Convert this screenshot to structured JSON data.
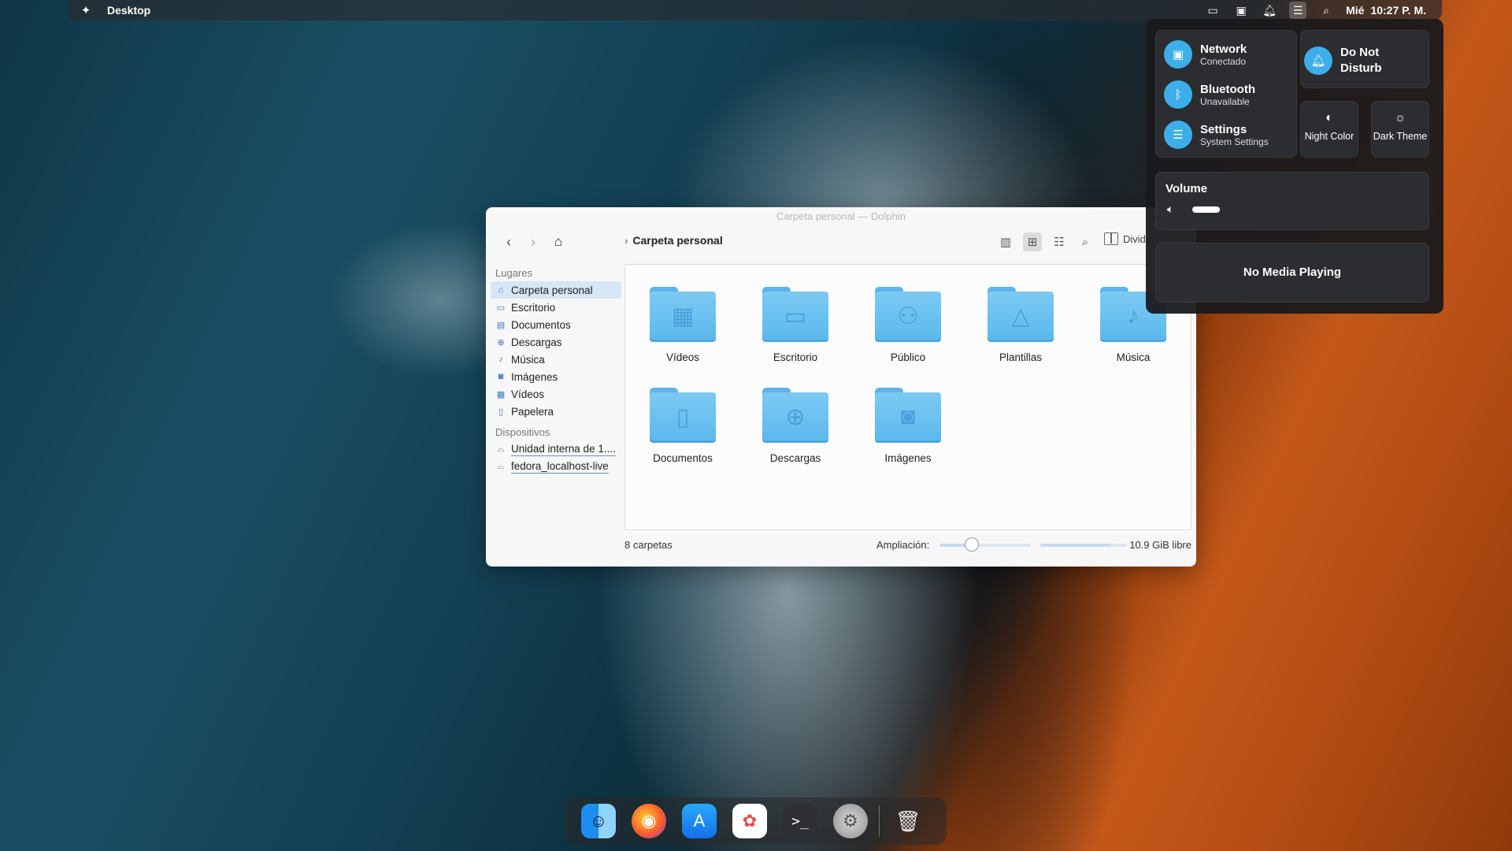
{
  "top_panel": {
    "title": "Desktop",
    "day": "Mié",
    "time": "10:27 P. M."
  },
  "window": {
    "title": "Carpeta personal — Dolphin",
    "breadcrumb": "Carpeta personal",
    "split_label": "Dividir",
    "status_count": "8 carpetas",
    "zoom_label": "Ampliación:",
    "zoom_fraction": 0.35,
    "free_space": "10.9 GiB libre",
    "used_fraction": 0.82
  },
  "sidebar": {
    "places_header": "Lugares",
    "places": [
      {
        "label": "Carpeta personal",
        "icon": "home-icon"
      },
      {
        "label": "Escritorio",
        "icon": "desktop-icon"
      },
      {
        "label": "Documentos",
        "icon": "documents-icon"
      },
      {
        "label": "Descargas",
        "icon": "downloads-icon"
      },
      {
        "label": "Música",
        "icon": "music-icon"
      },
      {
        "label": "Imágenes",
        "icon": "pictures-icon"
      },
      {
        "label": "Vídeos",
        "icon": "videos-icon"
      },
      {
        "label": "Papelera",
        "icon": "trash-icon"
      }
    ],
    "devices_header": "Dispositivos",
    "devices": [
      {
        "label": "Unidad interna de 1...."
      },
      {
        "label": "fedora_localhost-live"
      }
    ]
  },
  "folders": [
    {
      "label": "Vídeos",
      "icon": "film-icon"
    },
    {
      "label": "Escritorio",
      "icon": "desktop-icon"
    },
    {
      "label": "Público",
      "icon": "people-icon"
    },
    {
      "label": "Plantillas",
      "icon": "templates-icon"
    },
    {
      "label": "Música",
      "icon": "music-icon"
    },
    {
      "label": "Documentos",
      "icon": "document-icon"
    },
    {
      "label": "Descargas",
      "icon": "download-icon"
    },
    {
      "label": "Imágenes",
      "icon": "camera-icon"
    }
  ],
  "control_center": {
    "network": {
      "title": "Network",
      "subtitle": "Conectado"
    },
    "bluetooth": {
      "title": "Bluetooth",
      "subtitle": "Unavailable"
    },
    "settings": {
      "title": "Settings",
      "subtitle": "System Settings"
    },
    "dnd": {
      "title": "Do Not Disturb"
    },
    "night_color": {
      "label": "Night Color"
    },
    "dark_theme": {
      "label": "Dark Theme"
    },
    "volume": {
      "title": "Volume",
      "level": 0.12
    },
    "media": {
      "text": "No Media Playing"
    }
  },
  "dock": {
    "apps": [
      "finder-icon",
      "firefox-icon",
      "app-store-icon",
      "photos-icon",
      "terminal-icon",
      "system-settings-icon",
      "trash-icon"
    ]
  },
  "colors": {
    "accent": "#3daee9",
    "folder": "#6cc1f0",
    "selection": "#d6e6f5"
  }
}
